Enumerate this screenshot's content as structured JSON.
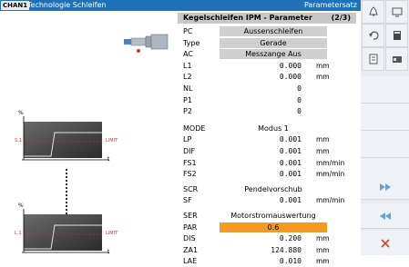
{
  "header": {
    "channel": "CHAN1",
    "title": "Technologie Schleifen",
    "right_title": "Parametersatz"
  },
  "panel": {
    "title": "Kegelschleifen IPM - Parameter",
    "page": "(2/3)",
    "rows": [
      {
        "label": "PC",
        "value": "Aussenschleifen",
        "unit": "",
        "style": "gray"
      },
      {
        "label": "Type",
        "value": "Gerade",
        "unit": "",
        "style": "gray"
      },
      {
        "label": "AC",
        "value": "Messzange Aus",
        "unit": "",
        "style": "gray"
      },
      {
        "label": "L1",
        "value": "0.000",
        "unit": "mm",
        "style": "num"
      },
      {
        "label": "L2",
        "value": "0.000",
        "unit": "mm",
        "style": "num"
      },
      {
        "label": "NL",
        "value": "0",
        "unit": "",
        "style": "num"
      },
      {
        "label": "P1",
        "value": "0",
        "unit": "",
        "style": "num"
      },
      {
        "label": "P2",
        "value": "0",
        "unit": "",
        "style": "num"
      },
      {
        "label": "MODE",
        "value": "Modus 1",
        "unit": "",
        "style": "plain"
      },
      {
        "label": "LP",
        "value": "0.001",
        "unit": "mm",
        "style": "num"
      },
      {
        "label": "DIF",
        "value": "0.001",
        "unit": "mm",
        "style": "num"
      },
      {
        "label": "FS1",
        "value": "0.001",
        "unit": "mm/min",
        "style": "num"
      },
      {
        "label": "FS2",
        "value": "0.001",
        "unit": "mm/min",
        "style": "num"
      },
      {
        "label": "SCR",
        "value": "Pendelvorschub",
        "unit": "",
        "style": "plain"
      },
      {
        "label": "SF",
        "value": "0.001",
        "unit": "mm/min",
        "style": "num"
      },
      {
        "label": "SER",
        "value": "Motorstromauswertung",
        "unit": "",
        "style": "plain"
      },
      {
        "label": "PAR",
        "value": "0.6",
        "unit": "",
        "style": "orange"
      },
      {
        "label": "DIS",
        "value": "0.200",
        "unit": "mm",
        "style": "num"
      },
      {
        "label": "ZA1",
        "value": "124.880",
        "unit": "mm",
        "style": "num"
      },
      {
        "label": "LAE",
        "value": "0.010",
        "unit": "mm",
        "style": "num"
      }
    ]
  },
  "graphs": {
    "y_unit": "%",
    "x_unit": "t",
    "limit_label": "LIMIT",
    "top": {
      "level_label": "S.1"
    },
    "bottom": {
      "level_label": "L.1"
    }
  },
  "softkeys": {
    "icons": [
      "undo-icon",
      "calculator-icon",
      "page-icon",
      "id-card-icon",
      "return-icon",
      "fast-forward-icon",
      "rewind-icon",
      "cancel-icon"
    ],
    "colors": {
      "accent": "#4a8fd1",
      "cancel": "#e03a2a"
    }
  },
  "colors": {
    "header": "#1e71b8",
    "highlight": "#f79a1c",
    "field_gray": "#cfcfcf",
    "limit_red": "#e0302a"
  }
}
